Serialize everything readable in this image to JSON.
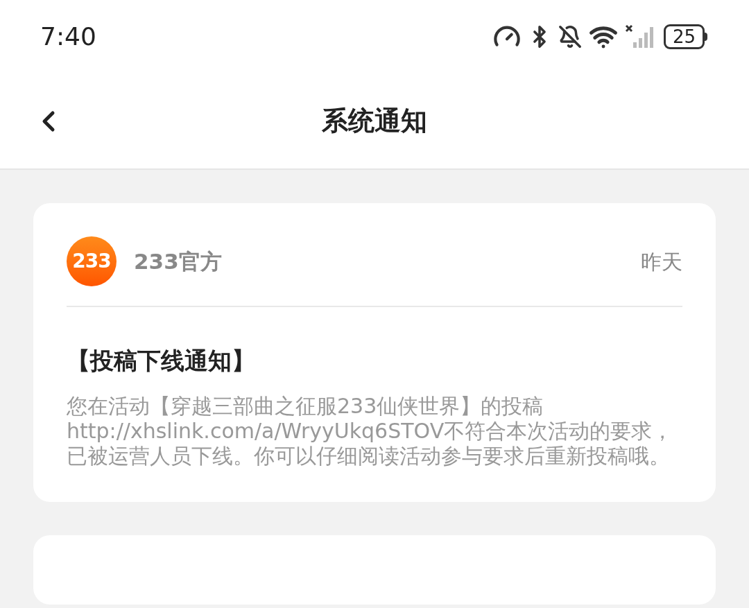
{
  "status_bar": {
    "time": "7:40",
    "battery": "25"
  },
  "header": {
    "title": "系统通知"
  },
  "notifications": [
    {
      "avatar_text": "233",
      "sender": "233官方",
      "time": "昨天",
      "title": "【投稿下线通知】",
      "body": "您在活动【穿越三部曲之征服233仙侠世界】的投稿http://xhslink.com/a/WryyUkq6STOV不符合本次活动的要求，已被运营人员下线。你可以仔细阅读活动参与要求后重新投稿哦。"
    }
  ]
}
